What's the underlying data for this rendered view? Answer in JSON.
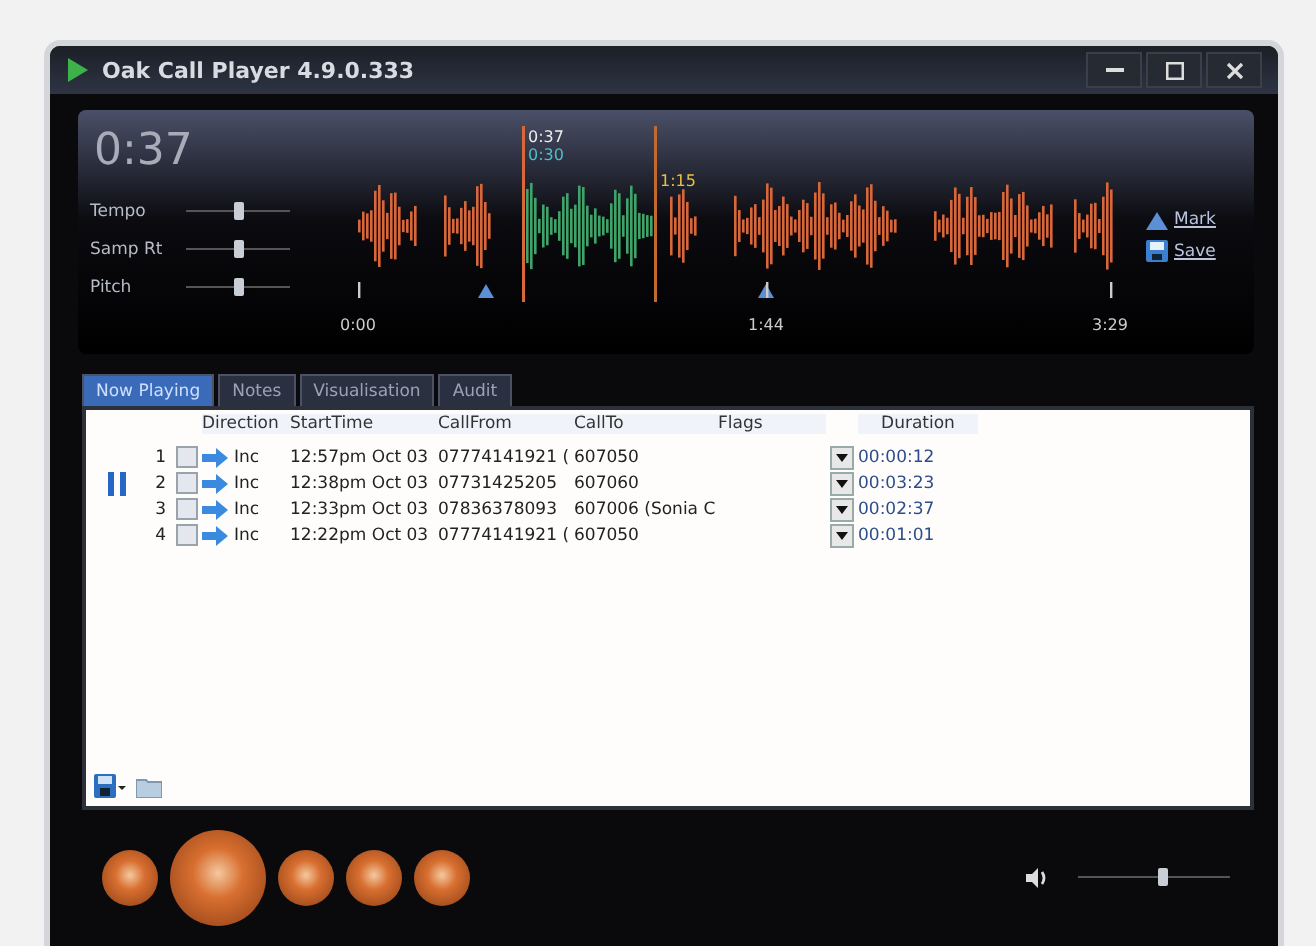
{
  "window": {
    "title": "Oak Call Player 4.9.0.333"
  },
  "player": {
    "position": "0:37",
    "sliders": [
      {
        "label": "Tempo",
        "level": 0.5
      },
      {
        "label": "Samp Rt",
        "level": 0.5
      },
      {
        "label": "Pitch",
        "level": 0.5
      }
    ],
    "waveform": {
      "playhead": "0:37",
      "playhead_sub": "0:30",
      "marker": "1:15",
      "axis": [
        "0:00",
        "1:44",
        "3:29"
      ]
    },
    "actions": [
      {
        "label": "Mark",
        "kind": "mark"
      },
      {
        "label": "Save",
        "kind": "save"
      }
    ]
  },
  "tabs": [
    {
      "label": "Now Playing",
      "selected": true
    },
    {
      "label": "Notes",
      "selected": false
    },
    {
      "label": "Visualisation",
      "selected": false
    },
    {
      "label": "Audit",
      "selected": false
    }
  ],
  "table": {
    "columns": [
      "Direction",
      "StartTime",
      "CallFrom",
      "CallTo",
      "Flags",
      "Duration"
    ],
    "rows": [
      {
        "number": "1",
        "checked": false,
        "playing": false,
        "direction": "Inc",
        "start": "12:57pm Oct 03",
        "from": "07774141921 (",
        "to": "607050",
        "duration": "00:00:12"
      },
      {
        "number": "2",
        "checked": false,
        "playing": true,
        "direction": "Inc",
        "start": "12:38pm Oct 03",
        "from": "07731425205",
        "to": "607060",
        "duration": "00:03:23"
      },
      {
        "number": "3",
        "checked": false,
        "playing": false,
        "direction": "Inc",
        "start": "12:33pm Oct 03",
        "from": "07836378093",
        "to": "607006 (Sonia C",
        "duration": "00:02:37"
      },
      {
        "number": "4",
        "checked": false,
        "playing": false,
        "direction": "Inc",
        "start": "12:22pm Oct 03",
        "from": "07774141921 (",
        "to": "607050",
        "duration": "00:01:01"
      }
    ]
  },
  "volume": {
    "level": 0.55
  }
}
